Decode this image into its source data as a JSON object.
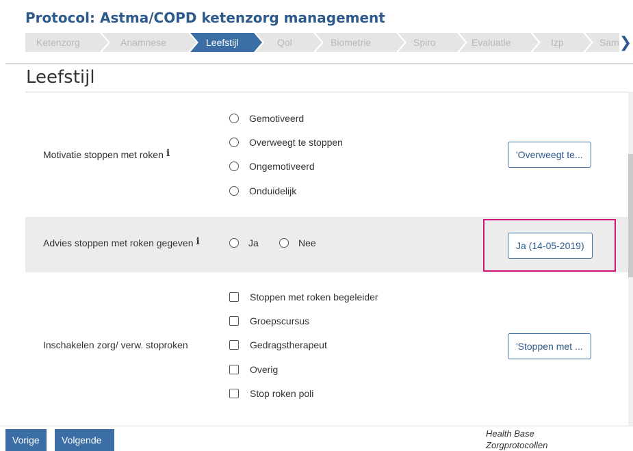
{
  "protocol_title": "Protocol: Astma/COPD ketenzorg management",
  "steps": [
    "Ketenzorg",
    "Anamnese",
    "Leefstijl",
    "Qol",
    "Biometrie",
    "Spiro",
    "Evaluatie",
    "Izp",
    "Same"
  ],
  "active_step": "Leefstijl",
  "icons": {
    "steps_next": "chevron-right-icon",
    "info": "info-icon"
  },
  "section_title": "Leefstijl",
  "questions": {
    "motivation": {
      "label": "Motivatie stoppen met roken",
      "info": "i",
      "options": [
        "Gemotiveerd",
        "Overweegt te stoppen",
        "Ongemotiveerd",
        "Onduidelijk"
      ],
      "history_button": "'Overweegt te..."
    },
    "advice": {
      "label": "Advies stoppen met roken gegeven",
      "info": "i",
      "options": [
        "Ja",
        "Nee"
      ],
      "history_button": "Ja (14-05-2019)"
    },
    "referral": {
      "label": "Inschakelen zorg/ verw. stoproken",
      "options": [
        "Stoppen met roken begeleider",
        "Groepscursus",
        "Gedragstherapeut",
        "Overig",
        "Stop roken poli"
      ],
      "history_button": "'Stoppen met ..."
    }
  },
  "footer": {
    "prev_label": "Vorige",
    "next_label": "Volgende",
    "brand_line1": "Health Base",
    "brand_line2": "Zorgprotocollen"
  },
  "colors": {
    "primary": "#3a6ea5",
    "title": "#2d5a8a",
    "step_inactive": "#e5e5e5",
    "highlight": "#d0187c",
    "row_shaded": "#ececec"
  }
}
